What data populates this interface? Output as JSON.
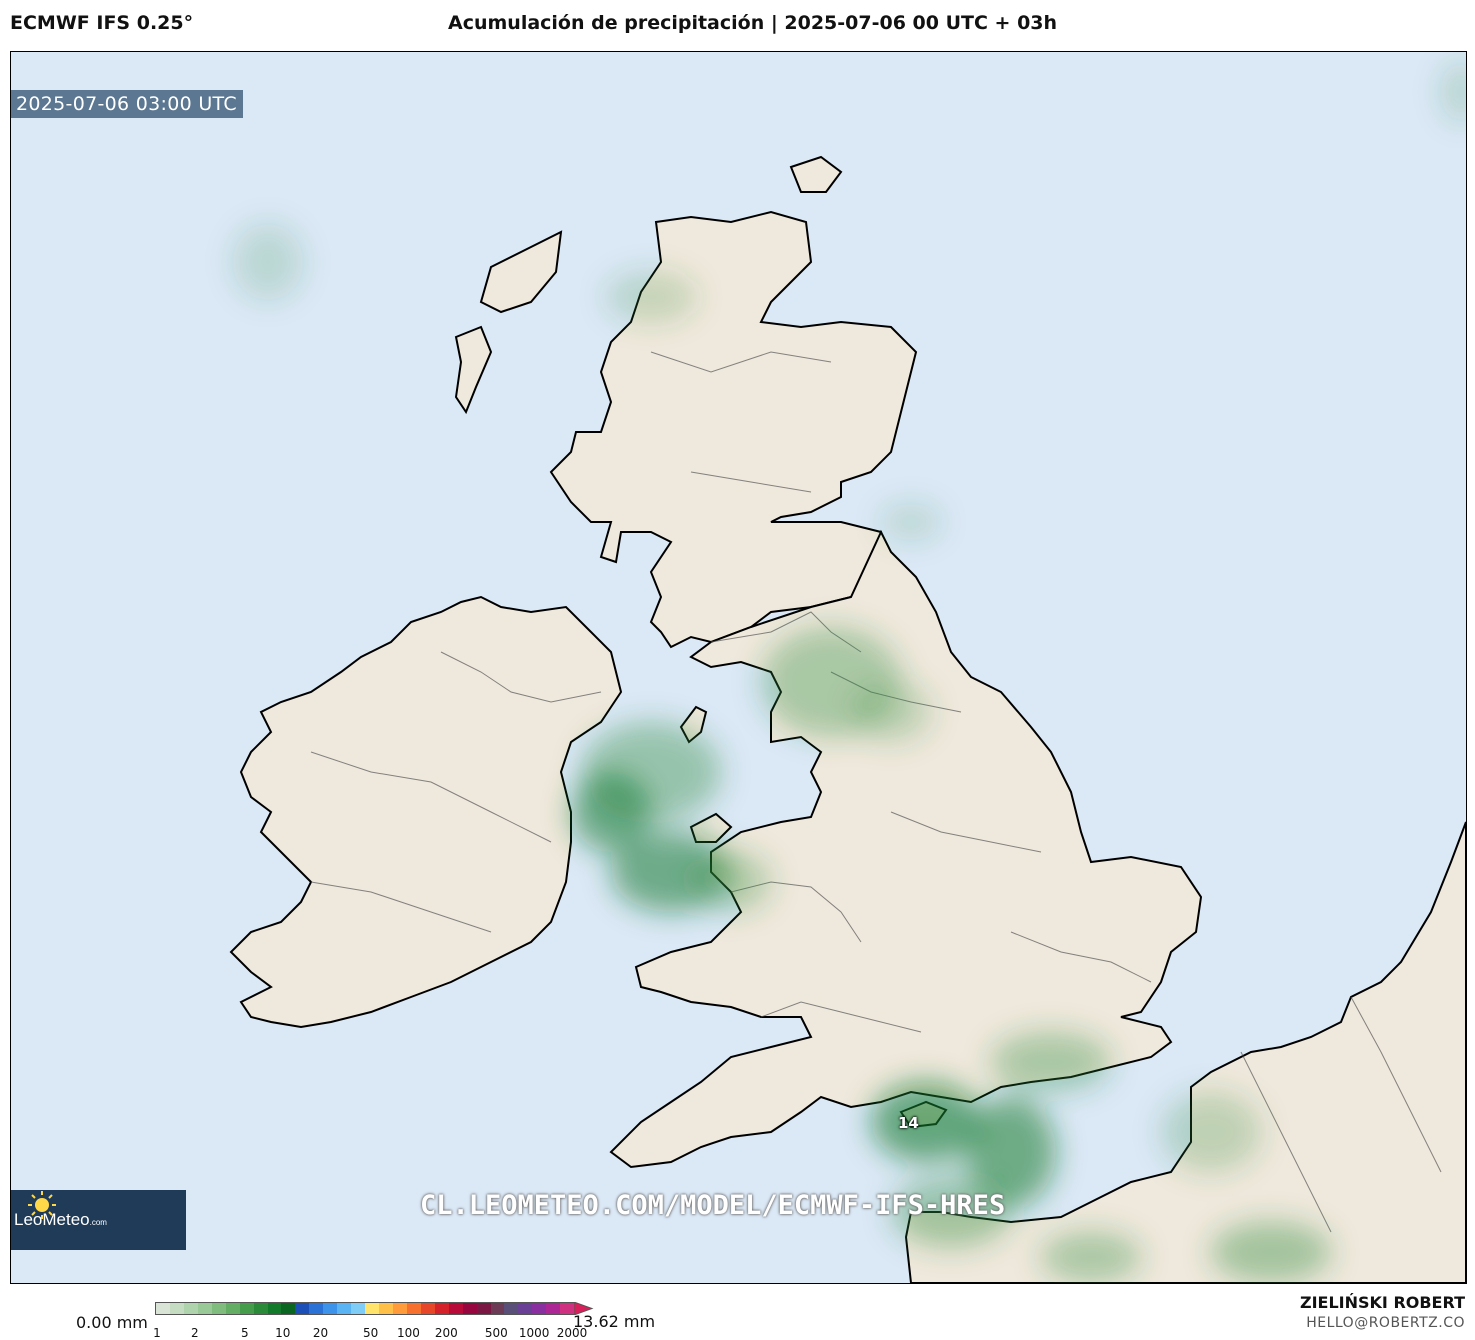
{
  "header": {
    "model": "ECMWF IFS 0.25°",
    "title": "Acumulación de precipitación | 2025-07-06 00 UTC + 03h"
  },
  "map": {
    "valid_time": "2025-07-06 03:00 UTC",
    "max_label": "14",
    "watermark": "CL.LEOMETEO.COM/MODEL/ECMWF-IFS-HRES",
    "logo": {
      "name": "LeoMeteo",
      "suffix": ".com"
    },
    "colors": {
      "sea": "#dbe8f6",
      "land": "#efe8dc",
      "precip": "#2e8b3d"
    }
  },
  "colorbar": {
    "min_label": "0.00 mm",
    "max_label": "13.62 mm",
    "ticks": [
      "1",
      "2",
      "5",
      "10",
      "20",
      "50",
      "100",
      "200",
      "500",
      "1000",
      "2000"
    ],
    "colors": [
      "#d9e4d6",
      "#c5dcc3",
      "#afd3ac",
      "#98c996",
      "#7fbc7d",
      "#63ae64",
      "#459c4b",
      "#2b8a39",
      "#137a2b",
      "#0a6621",
      "#1c4fb8",
      "#2a72d6",
      "#3d93ea",
      "#5ab3f2",
      "#7fcdf6",
      "#ffe36b",
      "#ffc04a",
      "#ff9b3a",
      "#f7702e",
      "#e84628",
      "#d5222a",
      "#b80b3a",
      "#98063f",
      "#7a1742",
      "#6e3b57",
      "#5a4f79",
      "#6a3f96",
      "#8a2fa0",
      "#ac2696",
      "#d03080"
    ]
  },
  "footer": {
    "author": "ZIELIŃSKI ROBERT",
    "email": "HELLO@ROBERTZ.CO"
  }
}
